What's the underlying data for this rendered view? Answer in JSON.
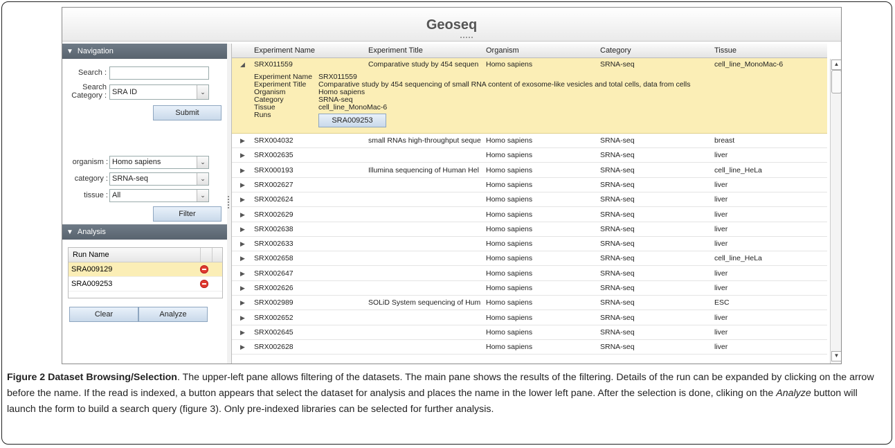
{
  "window": {
    "title": "Geoseq"
  },
  "navigation": {
    "header": "Navigation",
    "search_label": "Search :",
    "search_value": "",
    "search_category_label_1": "Search",
    "search_category_label_2": "Category :",
    "search_category_value": "SRA ID",
    "submit_label": "Submit",
    "organism_label": "organism :",
    "organism_value": "Homo sapiens",
    "category_label": "category :",
    "category_value": "SRNA-seq",
    "tissue_label": "tissue :",
    "tissue_value": "All",
    "filter_label": "Filter"
  },
  "analysis": {
    "header": "Analysis",
    "column_header": "Run Name",
    "runs": [
      "SRA009129",
      "SRA009253"
    ],
    "clear_label": "Clear",
    "analyze_label": "Analyze"
  },
  "grid": {
    "columns": [
      "Experiment Name",
      "Experiment Title",
      "Organism",
      "Category",
      "Tissue"
    ],
    "expanded": {
      "name": "SRX011559",
      "title": "Comparative study by 454 sequen",
      "organism": "Homo sapiens",
      "category": "SRNA-seq",
      "tissue": "cell_line_MonoMac-6",
      "detail_labels": [
        "Experiment Name",
        "Experiment Title",
        "Organism",
        "Category",
        "Tissue",
        "Runs"
      ],
      "detail_values": [
        "SRX011559",
        "Comparative study by 454 sequencing of small RNA content of exosome-like vesicles and total cells, data from cells",
        "Homo sapiens",
        "SRNA-seq",
        "cell_line_MonoMac-6"
      ],
      "run_button": "SRA009253"
    },
    "rows": [
      {
        "name": "SRX004032",
        "title": "small RNAs high-throughput seque",
        "organism": "Homo sapiens",
        "category": "SRNA-seq",
        "tissue": "breast"
      },
      {
        "name": "SRX002635",
        "title": "",
        "organism": "Homo sapiens",
        "category": "SRNA-seq",
        "tissue": "liver"
      },
      {
        "name": "SRX000193",
        "title": "Illumina sequencing of Human Hel",
        "organism": "Homo sapiens",
        "category": "SRNA-seq",
        "tissue": "cell_line_HeLa"
      },
      {
        "name": "SRX002627",
        "title": "",
        "organism": "Homo sapiens",
        "category": "SRNA-seq",
        "tissue": "liver"
      },
      {
        "name": "SRX002624",
        "title": "",
        "organism": "Homo sapiens",
        "category": "SRNA-seq",
        "tissue": "liver"
      },
      {
        "name": "SRX002629",
        "title": "",
        "organism": "Homo sapiens",
        "category": "SRNA-seq",
        "tissue": "liver"
      },
      {
        "name": "SRX002638",
        "title": "",
        "organism": "Homo sapiens",
        "category": "SRNA-seq",
        "tissue": "liver"
      },
      {
        "name": "SRX002633",
        "title": "",
        "organism": "Homo sapiens",
        "category": "SRNA-seq",
        "tissue": "liver"
      },
      {
        "name": "SRX002658",
        "title": "",
        "organism": "Homo sapiens",
        "category": "SRNA-seq",
        "tissue": "cell_line_HeLa"
      },
      {
        "name": "SRX002647",
        "title": "",
        "organism": "Homo sapiens",
        "category": "SRNA-seq",
        "tissue": "liver"
      },
      {
        "name": "SRX002626",
        "title": "",
        "organism": "Homo sapiens",
        "category": "SRNA-seq",
        "tissue": "liver"
      },
      {
        "name": "SRX002989",
        "title": "SOLiD System sequencing of Hum",
        "organism": "Homo sapiens",
        "category": "SRNA-seq",
        "tissue": "ESC"
      },
      {
        "name": "SRX002652",
        "title": "",
        "organism": "Homo sapiens",
        "category": "SRNA-seq",
        "tissue": "liver"
      },
      {
        "name": "SRX002645",
        "title": "",
        "organism": "Homo sapiens",
        "category": "SRNA-seq",
        "tissue": "liver"
      },
      {
        "name": "SRX002628",
        "title": "",
        "organism": "Homo sapiens",
        "category": "SRNA-seq",
        "tissue": "liver"
      }
    ]
  },
  "caption": {
    "bold": "Figure 2 Dataset Browsing/Selection",
    "text1": ". The upper-left pane allows filtering of the datasets. The main pane shows the results of the filtering. Details of the run can be expanded by clicking on the arrow before the name. If the read is indexed, a button appears that select the dataset for analysis and places the name in the lower left pane. After the selection is done, cliking on the ",
    "italic": "Analyze",
    "text2": " button will launch the form to build a search query (figure 3). Only pre-indexed libraries can be selected for further analysis."
  },
  "colors": {
    "selected_row": "#fbeeb6",
    "panel_header": "#646f7a",
    "remove": "#e03a2f"
  }
}
